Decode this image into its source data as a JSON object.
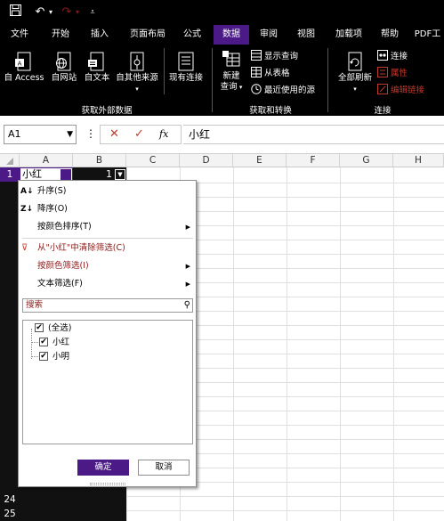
{
  "quick_access": {
    "save_icon": "save-icon",
    "undo_icon": "undo-icon",
    "redo_icon": "redo-icon",
    "customize_icon": "customize-icon"
  },
  "tabs": [
    {
      "label": "文件"
    },
    {
      "label": "开始"
    },
    {
      "label": "插入"
    },
    {
      "label": "页面布局"
    },
    {
      "label": "公式"
    },
    {
      "label": "数据"
    },
    {
      "label": "审阅"
    },
    {
      "label": "视图"
    },
    {
      "label": "加载项"
    },
    {
      "label": "帮助"
    },
    {
      "label": "PDF工"
    }
  ],
  "ribbon": {
    "get_external": {
      "from_access": "自 Access",
      "from_web": "自网站",
      "from_text": "自文本",
      "from_other_line1": "自其他来源",
      "existing_conn": "现有连接",
      "label": "获取外部数据"
    },
    "get_transform": {
      "new_query_line1": "新建",
      "new_query_line2": "查询",
      "show_queries": "显示查询",
      "from_table": "从表格",
      "recent_sources": "最近使用的源",
      "label": "获取和转换"
    },
    "connections": {
      "refresh_all_line1": "全部刷新",
      "connections": "连接",
      "properties": "属性",
      "edit_links": "编辑链接",
      "label": "连接"
    }
  },
  "formula_bar": {
    "name_box": "A1",
    "more": "⋮",
    "cancel": "✕",
    "enter": "✓",
    "fx": "fx",
    "content": "小红"
  },
  "grid": {
    "columns": [
      "A",
      "B",
      "C",
      "D",
      "E",
      "F",
      "G",
      "H"
    ],
    "cell_a1": "小红",
    "cell_b1": "1",
    "visible_rows": [
      "1",
      "24",
      "25"
    ]
  },
  "filter_menu": {
    "sort_asc": "升序(S)",
    "sort_desc": "降序(O)",
    "sort_by_color": "按颜色排序(T)",
    "clear_filter": "从\"小红\"中清除筛选(C)",
    "filter_by_color": "按颜色筛选(I)",
    "text_filter": "文本筛选(F)",
    "search_placeholder": "搜索",
    "items": [
      {
        "label": "(全选)",
        "checked": true
      },
      {
        "label": "小红",
        "checked": true
      },
      {
        "label": "小明",
        "checked": true
      }
    ],
    "ok": "确定",
    "cancel": "取消"
  },
  "colors": {
    "accent": "#4b1a87",
    "ribbon_bg": "#000000",
    "menu_disabled": "#8b1a1a"
  }
}
